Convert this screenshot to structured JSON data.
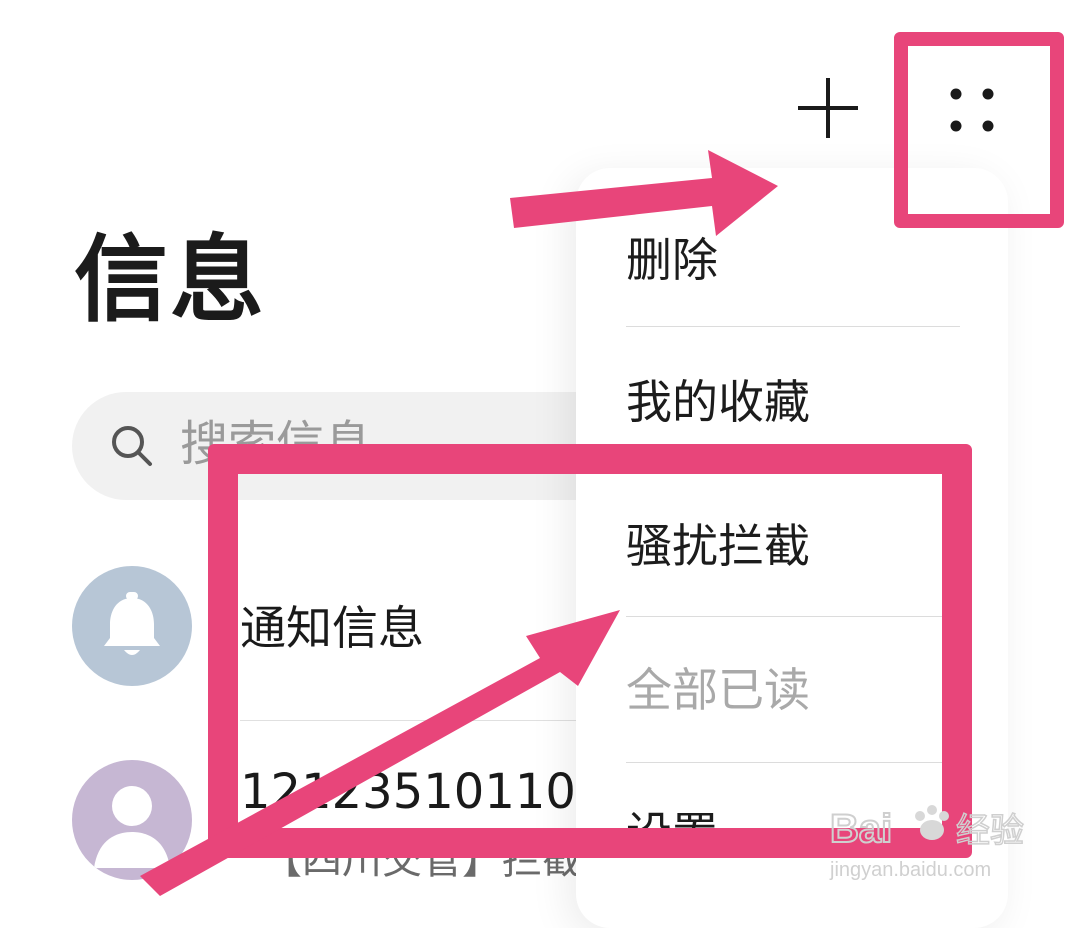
{
  "header": {
    "title": "信息",
    "add_icon": "plus-icon",
    "more_icon": "more-dots-icon"
  },
  "search": {
    "placeholder": "搜索信息",
    "icon": "search-icon"
  },
  "conversations": [
    {
      "title": "通知信息",
      "icon": "bell-icon"
    },
    {
      "title": "12123510110",
      "subtitle": "【四川交管】拦截",
      "icon": "person-icon"
    }
  ],
  "menu": {
    "items": [
      {
        "label": "删除",
        "enabled": true
      },
      {
        "label": "我的收藏",
        "enabled": true
      },
      {
        "label": "骚扰拦截",
        "enabled": true
      },
      {
        "label": "全部已读",
        "enabled": false
      },
      {
        "label": "设置",
        "enabled": true
      }
    ]
  },
  "watermark": {
    "brand": "Bai",
    "brand_cn": "经验",
    "url": "jingyan.baidu.com"
  },
  "colors": {
    "annotation": "#e8457a",
    "avatar_bell": "#b7c6d6",
    "avatar_user": "#c6b7d3",
    "disabled_text": "#a9a9a9"
  }
}
